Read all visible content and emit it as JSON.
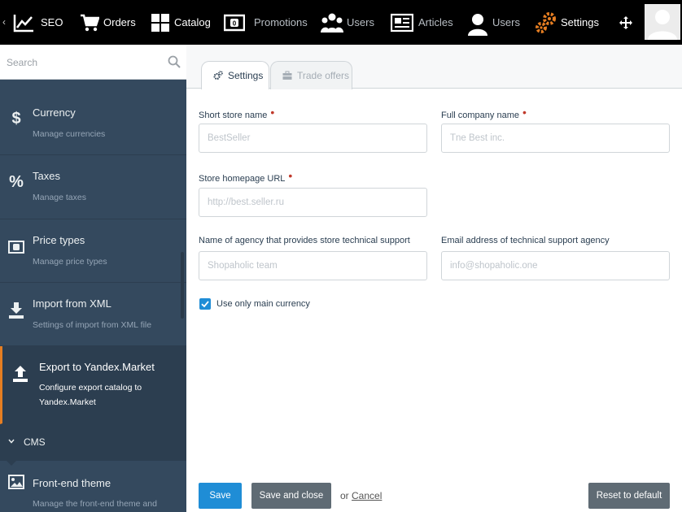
{
  "nav": {
    "back_label": "‹",
    "items": [
      {
        "label": "SEO",
        "icon": "chart-line-icon"
      },
      {
        "label": "Orders",
        "icon": "cart-icon"
      },
      {
        "label": "Catalog",
        "icon": "grid-icon"
      },
      {
        "label": "Promotions",
        "icon": "money-icon"
      },
      {
        "label": "Users",
        "icon": "users-group-icon"
      },
      {
        "label": "Articles",
        "icon": "newspaper-icon"
      },
      {
        "label": "Users",
        "icon": "user-icon"
      },
      {
        "label": "Settings",
        "icon": "gears-icon"
      }
    ],
    "move_icon": "move-icon",
    "colors": {
      "bar": "#000000",
      "settings_icon": "#e67e22"
    }
  },
  "sidebar": {
    "search_placeholder": "Search",
    "items": [
      {
        "title": "Currency",
        "desc": "Manage currencies",
        "icon": "dollar-icon"
      },
      {
        "title": "Taxes",
        "desc": "Manage taxes",
        "icon": "percent-icon"
      },
      {
        "title": "Price types",
        "desc": "Manage price types",
        "icon": "money-icon"
      },
      {
        "title": "Import from XML",
        "desc": "Settings of import from XML file",
        "icon": "download-icon"
      },
      {
        "title": "Export to Yandex.Market",
        "desc": "Configure export catalog to Yandex.Market",
        "icon": "upload-icon",
        "active": true
      }
    ],
    "section": {
      "label": "CMS"
    },
    "cms_item": {
      "title": "Front-end theme",
      "desc": "Manage the front-end theme and",
      "icon": "picture-icon"
    },
    "colors": {
      "bg": "#34495e",
      "active_border": "#e67e22"
    }
  },
  "tabs": [
    {
      "label": "Settings",
      "icon": "gears-icon"
    },
    {
      "label": "Trade offers",
      "icon": "briefcase-icon"
    }
  ],
  "form": {
    "short_name": {
      "label": "Short store name",
      "placeholder": "BestSeller",
      "required": "•"
    },
    "full_name": {
      "label": "Full company name",
      "placeholder": "Tne Best inc.",
      "required": "•"
    },
    "homepage": {
      "label": "Store homepage URL",
      "placeholder": "http://best.seller.ru",
      "required": "•"
    },
    "agency": {
      "label": "Name of agency that provides store technical support",
      "placeholder": "Shopaholic team"
    },
    "agency_email": {
      "label": "Email address of technical support agency",
      "placeholder": "info@shopaholic.one"
    },
    "currency_checkbox": {
      "label": "Use only main currency",
      "checked": true
    }
  },
  "buttons": {
    "save": "Save",
    "save_close": "Save and close",
    "or": "or",
    "cancel": "Cancel",
    "reset": "Reset to default",
    "colors": {
      "primary": "#1f8dd6",
      "secondary": "#5f6b74"
    }
  }
}
